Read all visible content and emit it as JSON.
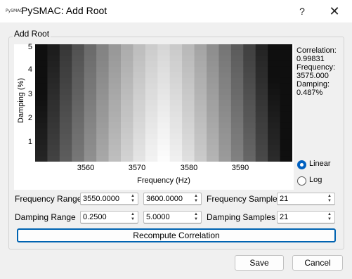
{
  "window": {
    "app_icon_text": "PySMAC",
    "title": "PySMAC: Add Root",
    "help_glyph": "?",
    "close_glyph": "✕"
  },
  "group": {
    "title": "Add Root"
  },
  "chart_data": {
    "type": "heatmap",
    "xlabel": "Frequency (Hz)",
    "ylabel": "Damping (%)",
    "x_ticks": [
      "3560",
      "3570",
      "3580",
      "3590"
    ],
    "y_ticks": [
      "5",
      "4",
      "3",
      "2",
      "1"
    ],
    "xlim": [
      3550,
      3600
    ],
    "ylim": [
      0.25,
      5.0
    ],
    "x_samples": 21,
    "y_samples": 21,
    "colormap": "grayscale (white = high correlation)",
    "peak": {
      "frequency": 3575.0,
      "damping": 0.487,
      "correlation": 0.99831
    }
  },
  "info": {
    "corr_label": "Correlation:",
    "corr_value": "0.99831",
    "freq_label": "Frequency:",
    "freq_value": "3575.000",
    "damp_label": "Damping:",
    "damp_value": "0.487%"
  },
  "scale": {
    "options": [
      {
        "label": "Linear",
        "selected": true
      },
      {
        "label": "Log",
        "selected": false
      }
    ]
  },
  "form": {
    "freq_range_label": "Frequency Range",
    "freq_min": "3550.0000",
    "freq_max": "3600.0000",
    "freq_samples_label": "Frequency Samples",
    "freq_samples": "21",
    "damp_range_label": "Damping Range",
    "damp_min": "0.2500",
    "damp_max": "5.0000",
    "damp_samples_label": "Damping Samples",
    "damp_samples": "21"
  },
  "buttons": {
    "recompute": "Recompute Correlation",
    "save": "Save",
    "cancel": "Cancel"
  },
  "colors": {
    "accent": "#0063b1",
    "window_bg": "#f0f0f0"
  }
}
